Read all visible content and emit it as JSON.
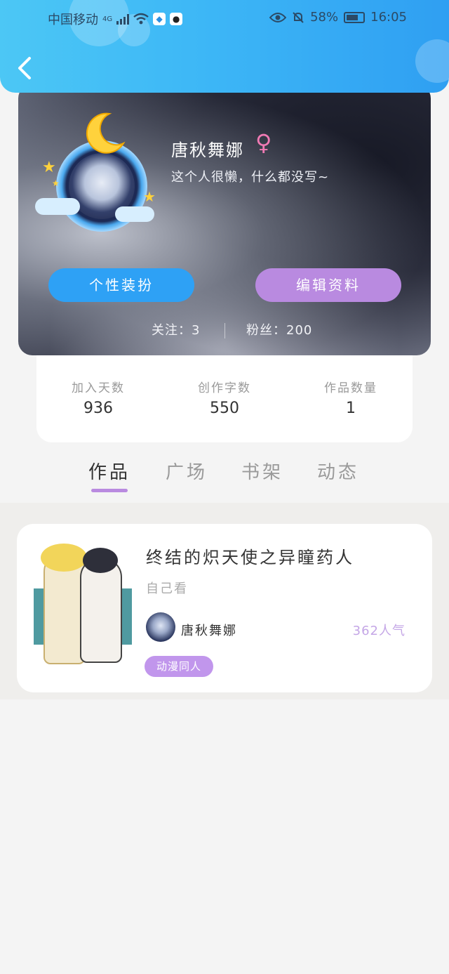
{
  "status_bar": {
    "carrier": "中国移动",
    "network": "4G",
    "battery": "58%",
    "time": "16:05"
  },
  "header": {
    "back_icon": "chevron-left-icon"
  },
  "profile": {
    "name": "唐秋舞娜",
    "gender_symbol": "♀",
    "bio": "这个人很懒，什么都没写~",
    "dress_button": "个性装扮",
    "edit_button": "编辑资料",
    "following_label": "关注：",
    "following_count": "3",
    "fans_label": "粉丝：",
    "fans_count": "200"
  },
  "stats": [
    {
      "label": "加入天数",
      "value": "936"
    },
    {
      "label": "创作字数",
      "value": "550"
    },
    {
      "label": "作品数量",
      "value": "1"
    }
  ],
  "tabs": [
    {
      "label": "作品",
      "active": true
    },
    {
      "label": "广场",
      "active": false
    },
    {
      "label": "书架",
      "active": false
    },
    {
      "label": "动态",
      "active": false
    }
  ],
  "works": [
    {
      "title": "终结的炽天使之异瞳药人",
      "description": "自己看",
      "author": "唐秋舞娜",
      "popularity": "362人气",
      "tag": "动漫同人"
    }
  ],
  "colors": {
    "header": "#3db7f6",
    "dress_button": "#2ea1f5",
    "edit_button": "#b98ae0",
    "tag": "#c196ec",
    "popularity": "#c4a6e6"
  }
}
